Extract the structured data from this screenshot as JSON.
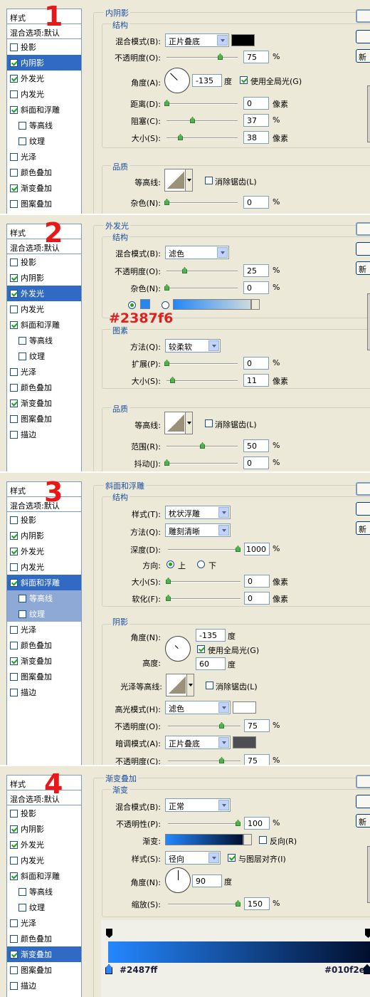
{
  "numbers": [
    "1",
    "2",
    "3",
    "4"
  ],
  "stylelist": {
    "title": "样式",
    "blend": "混合选项:默认",
    "items": [
      "投影",
      "内阴影",
      "外发光",
      "内发光",
      "斜面和浮雕",
      "等高线",
      "纹理",
      "光泽",
      "颜色叠加",
      "渐变叠加",
      "图案叠加",
      "描边"
    ]
  },
  "buttons": {
    "new": "新"
  },
  "common": {
    "structure": "结构",
    "quality": "品质",
    "blend_mode": "混合模式(B):",
    "opacity": "不透明度(O):",
    "noise": "杂色(N):",
    "angle": "角度(A):",
    "degree": "度",
    "use_global": "使用全局光(G)",
    "distance": "距离(D):",
    "choke": "阻塞(C):",
    "size": "大小(S):",
    "contour": "等高线:",
    "antialias": "消除锯齿(L)",
    "pct": "%",
    "px": "像素"
  },
  "panel1": {
    "title": "内阴影",
    "blend_value": "正片叠底",
    "opacity": "75",
    "angle": "-135",
    "distance": "0",
    "choke": "37",
    "size": "38",
    "noise": "0",
    "shadow_color": "#000000"
  },
  "panel2": {
    "title": "外发光",
    "blend_value": "滤色",
    "opacity": "25",
    "noise": "0",
    "color_note": "#2387f6",
    "glow_color": "#2387f6",
    "elements": "图素",
    "technique_label": "方法(Q):",
    "technique": "较柔软",
    "spread_label": "扩展(P):",
    "spread": "0",
    "size": "11",
    "range_label": "范围(R):",
    "range": "50",
    "jitter_label": "抖动(J):",
    "jitter": "0"
  },
  "panel3": {
    "title": "斜面和浮雕",
    "style_label": "样式(T):",
    "style": "枕状浮雕",
    "technique_label": "方法(Q):",
    "technique": "雕刻清晰",
    "depth_label": "深度(D):",
    "depth": "1000",
    "direction_label": "方向:",
    "dir_up": "上",
    "dir_down": "下",
    "size": "0",
    "soften_label": "软化(F):",
    "soften": "0",
    "shading": "阴影",
    "angle_label": "角度(N):",
    "angle": "-135",
    "altitude_label": "高度:",
    "altitude": "60",
    "gloss_label": "光泽等高线:",
    "highlight_label": "高光模式(H):",
    "highlight_mode": "滤色",
    "highlight_opacity": "75",
    "shadow_label": "暗调模式(A):",
    "shadow_mode": "正片叠底",
    "shadow_opacity_label": "不透明度(C):",
    "shadow_opacity": "75",
    "highlight_color": "#ffffff",
    "shadow_color": "#4d4d52"
  },
  "panel4": {
    "title": "渐变叠加",
    "gradient_group": "渐变",
    "blend_value": "正常",
    "opacity_label": "不透明性(P):",
    "opacity": "100",
    "gradient_label": "渐变:",
    "reverse": "反向(R)",
    "style_label": "样式(S):",
    "style": "径向",
    "align": "与图层对齐(I)",
    "angle_label": "角度(N):",
    "angle": "90",
    "scale_label": "缩放(S):",
    "scale": "150",
    "start_color": "#2487ff",
    "end_color": "#010f2e"
  }
}
